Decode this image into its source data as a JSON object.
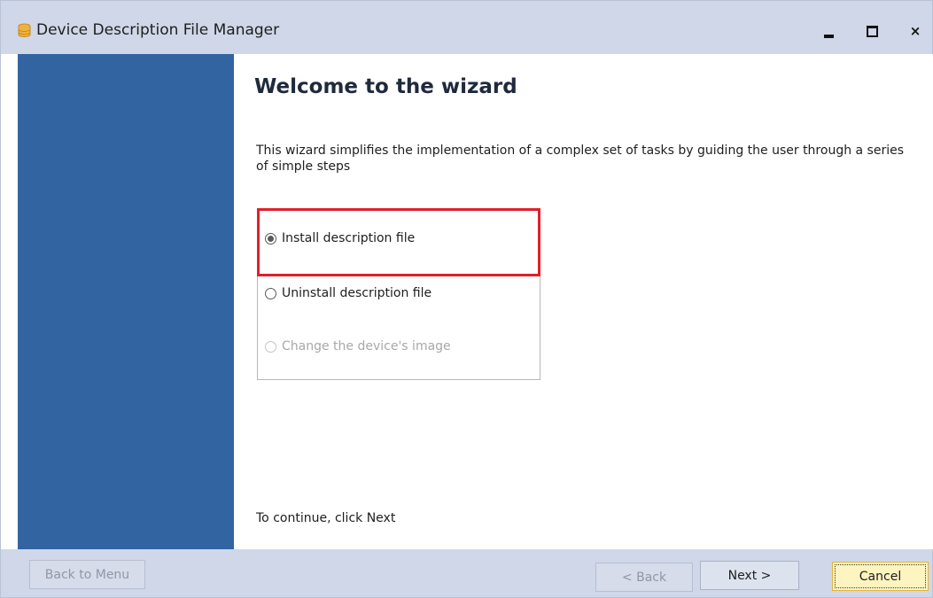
{
  "window": {
    "title": "Device Description File Manager",
    "app_icon": "database-icon",
    "controls": {
      "minimize_icon": "minimize-icon",
      "maximize_icon": "maximize-icon",
      "close_icon": "close-icon",
      "close_glyph": "×"
    }
  },
  "wizard": {
    "heading": "Welcome to the wizard",
    "description": "This wizard simplifies the implementation of a complex set of tasks by guiding the user through a series of simple steps",
    "options": [
      {
        "label": "Install description file",
        "selected": true,
        "enabled": true
      },
      {
        "label": "Uninstall description file",
        "selected": false,
        "enabled": true
      },
      {
        "label": "Change the device's image",
        "selected": false,
        "enabled": false
      }
    ],
    "continue_hint": "To continue, click Next"
  },
  "footer": {
    "back_to_menu_label": "Back to Menu",
    "back_label": "< Back",
    "next_label": "Next >",
    "cancel_label": "Cancel"
  },
  "colors": {
    "sidebar": "#3264a2",
    "titlebar": "#cfd7e8",
    "highlight": "#e0202a",
    "cancel_button": "#fdf4bf"
  }
}
